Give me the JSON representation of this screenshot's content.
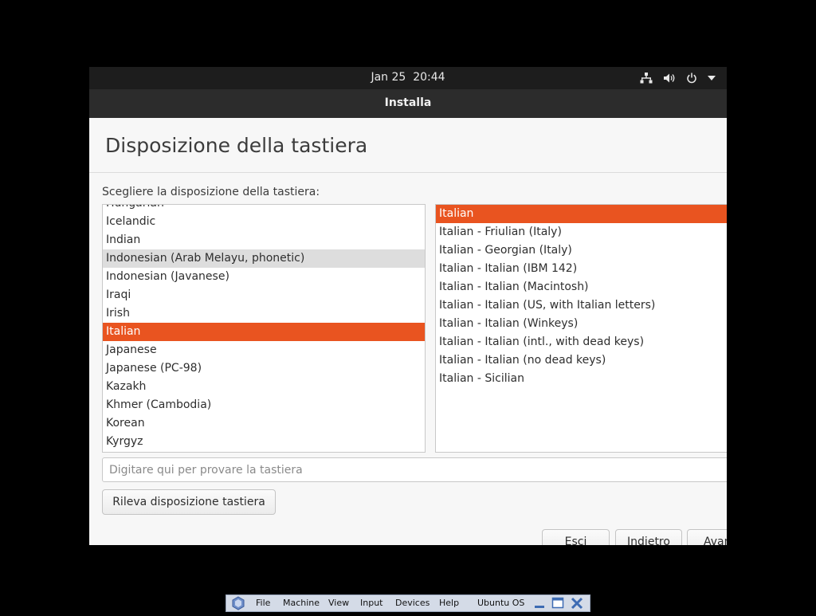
{
  "topbar": {
    "date": "Jan 25",
    "time": "20:44",
    "icons": [
      "network-icon",
      "volume-icon",
      "power-icon",
      "chevron-down-icon"
    ]
  },
  "window": {
    "title": "Installa"
  },
  "page": {
    "title": "Disposizione della tastiera",
    "prompt": "Scegliere la disposizione della tastiera:"
  },
  "layouts": {
    "items": [
      "Hungarian",
      "Icelandic",
      "Indian",
      "Indonesian (Arab Melayu, phonetic)",
      "Indonesian (Javanese)",
      "Iraqi",
      "Irish",
      "Italian",
      "Japanese",
      "Japanese (PC-98)",
      "Kazakh",
      "Khmer (Cambodia)",
      "Korean",
      "Kyrgyz"
    ],
    "selected": "Italian",
    "highlighted": "Indonesian (Arab Melayu, phonetic)"
  },
  "variants": {
    "items": [
      "Italian",
      "Italian - Friulian (Italy)",
      "Italian - Georgian (Italy)",
      "Italian - Italian (IBM 142)",
      "Italian - Italian (Macintosh)",
      "Italian - Italian (US, with Italian letters)",
      "Italian - Italian (Winkeys)",
      "Italian - Italian (intl., with dead keys)",
      "Italian - Italian (no dead keys)",
      "Italian - Sicilian"
    ],
    "selected": "Italian"
  },
  "test_input": {
    "placeholder": "Digitare qui per provare la tastiera",
    "value": ""
  },
  "buttons": {
    "detect": "Rileva disposizione tastiera",
    "quit": "Esci",
    "back": "Indietro",
    "next": "Avanti"
  },
  "colors": {
    "accent": "#e95420",
    "topbar": "#1d1d1d",
    "titlebar": "#2c2c2c",
    "highlight": "#dddddd"
  },
  "vbox_menu": {
    "items": [
      "File",
      "Machine",
      "View",
      "Input",
      "Devices",
      "Help"
    ],
    "vm_name": "Ubuntu OS"
  }
}
